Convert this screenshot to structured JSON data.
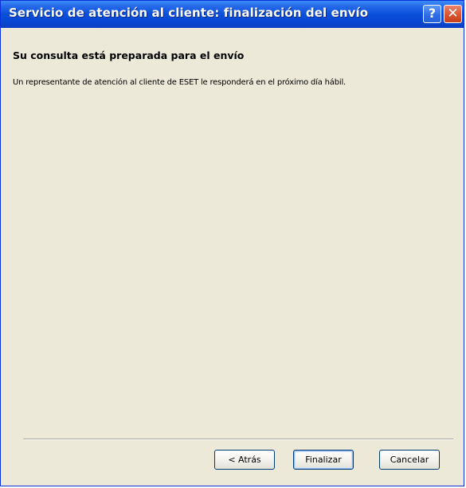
{
  "window": {
    "title": "Servicio de atención al cliente: finalización del envío",
    "help_label": "?",
    "close_label": "✕"
  },
  "main": {
    "heading": "Su consulta está preparada para el envío",
    "message": "Un representante de atención al cliente de ESET le responderá en el próximo día hábil."
  },
  "buttons": {
    "back": "< Atrás",
    "finish": "Finalizar",
    "cancel": "Cancelar"
  },
  "colors": {
    "titlebar": "#0a4fd9",
    "close_button": "#d8502c",
    "dialog_background": "#ece9d8"
  }
}
